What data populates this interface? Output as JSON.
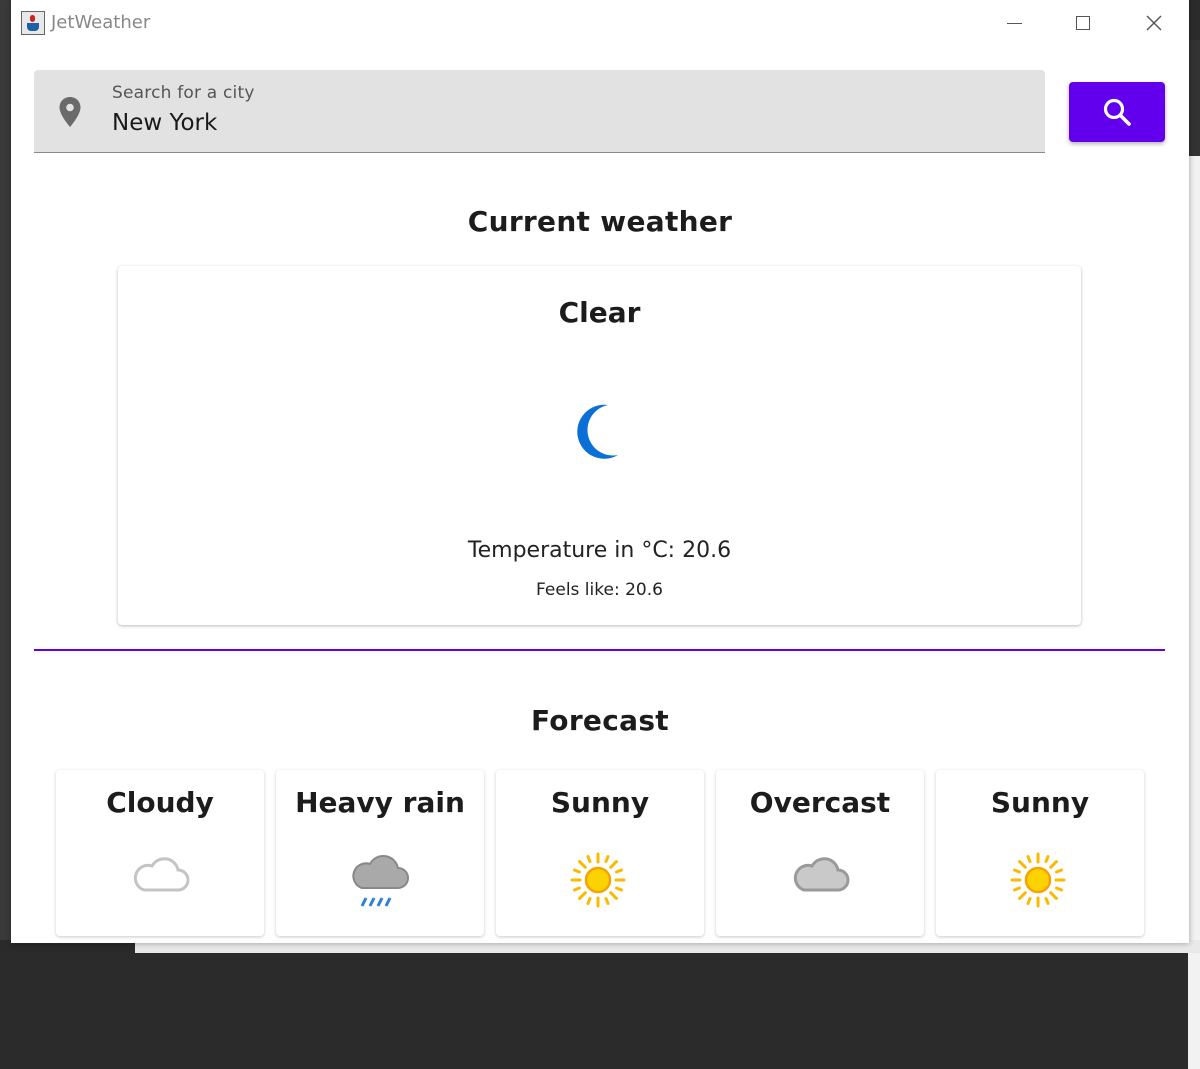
{
  "window": {
    "title": "JetWeather"
  },
  "search": {
    "label": "Search for a city",
    "value": "New York"
  },
  "current": {
    "heading": "Current weather",
    "condition": "Clear",
    "icon": "moon-icon",
    "temperature_text": "Temperature in °C: 20.6",
    "feels_text": "Feels like: 20.6"
  },
  "forecast": {
    "heading": "Forecast",
    "days": [
      {
        "condition": "Cloudy",
        "icon": "cloud-icon"
      },
      {
        "condition": "Heavy rain",
        "icon": "rain-cloud-icon"
      },
      {
        "condition": "Sunny",
        "icon": "sun-icon"
      },
      {
        "condition": "Overcast",
        "icon": "overcast-cloud-icon"
      },
      {
        "condition": "Sunny",
        "icon": "sun-icon"
      }
    ]
  },
  "colors": {
    "accent": "#6200ee",
    "moon": "#0a6fd6",
    "sun": "#fcb900",
    "cloud": "#bdbdbd"
  }
}
